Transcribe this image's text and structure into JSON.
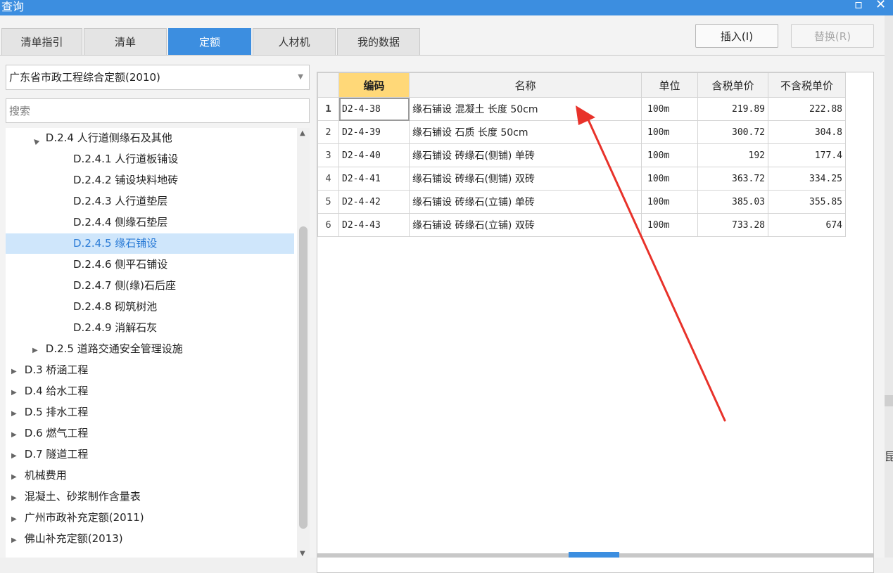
{
  "window": {
    "title": "查询",
    "restore_glyph": "▫",
    "close_glyph": "✕"
  },
  "tabs": [
    {
      "label": "清单指引",
      "active": false
    },
    {
      "label": "清单",
      "active": false
    },
    {
      "label": "定额",
      "active": true
    },
    {
      "label": "人材机",
      "active": false
    },
    {
      "label": "我的数据",
      "active": false
    }
  ],
  "actions": {
    "insert_label": "插入(I)",
    "replace_label": "替换(R)"
  },
  "library_select": {
    "value": "广东省市政工程综合定额(2010)"
  },
  "search": {
    "placeholder": "搜索"
  },
  "tree": [
    {
      "label": "D.2.4 人行道侧缘石及其他",
      "level": 1,
      "expander": "▲"
    },
    {
      "label": "D.2.4.1 人行道板铺设",
      "level": 2
    },
    {
      "label": "D.2.4.2 铺设块料地砖",
      "level": 2
    },
    {
      "label": "D.2.4.3 人行道垫层",
      "level": 2
    },
    {
      "label": "D.2.4.4 侧缘石垫层",
      "level": 2
    },
    {
      "label": "D.2.4.5 缘石铺设",
      "level": 2,
      "selected": true
    },
    {
      "label": "D.2.4.6 侧平石铺设",
      "level": 2
    },
    {
      "label": "D.2.4.7 侧(缘)石后座",
      "level": 2
    },
    {
      "label": "D.2.4.8 砌筑树池",
      "level": 2
    },
    {
      "label": "D.2.4.9 消解石灰",
      "level": 2
    },
    {
      "label": "D.2.5 道路交通安全管理设施",
      "level": 1,
      "expander": "▶"
    },
    {
      "label": "D.3 桥涵工程",
      "level": 0,
      "expander": "▶"
    },
    {
      "label": "D.4 给水工程",
      "level": 0,
      "expander": "▶"
    },
    {
      "label": "D.5 排水工程",
      "level": 0,
      "expander": "▶"
    },
    {
      "label": "D.6 燃气工程",
      "level": 0,
      "expander": "▶"
    },
    {
      "label": "D.7 隧道工程",
      "level": 0,
      "expander": "▶"
    },
    {
      "label": "机械费用",
      "level": 0,
      "expander": "▶"
    },
    {
      "label": "混凝土、砂浆制作含量表",
      "level": 0,
      "expander": "▶"
    },
    {
      "label": "广州市政补充定额(2011)",
      "level": 0,
      "expander": "▶"
    },
    {
      "label": "佛山补充定额(2013)",
      "level": 0,
      "expander": "▶"
    }
  ],
  "table": {
    "columns": [
      "编码",
      "名称",
      "单位",
      "含税单价",
      "不含税单价"
    ],
    "rows": [
      {
        "n": "1",
        "code": "D2-4-38",
        "name": "缘石铺设 混凝土 长度 50cm",
        "unit": "100m",
        "tax_price": "219.89",
        "notax_price": "222.88"
      },
      {
        "n": "2",
        "code": "D2-4-39",
        "name": "缘石铺设 石质 长度 50cm",
        "unit": "100m",
        "tax_price": "300.72",
        "notax_price": "304.8"
      },
      {
        "n": "3",
        "code": "D2-4-40",
        "name": "缘石铺设 砖缘石(侧铺) 单砖",
        "unit": "100m",
        "tax_price": "192",
        "notax_price": "177.4"
      },
      {
        "n": "4",
        "code": "D2-4-41",
        "name": "缘石铺设 砖缘石(侧铺) 双砖",
        "unit": "100m",
        "tax_price": "363.72",
        "notax_price": "334.25"
      },
      {
        "n": "5",
        "code": "D2-4-42",
        "name": "缘石铺设 砖缘石(立铺) 单砖",
        "unit": "100m",
        "tax_price": "385.03",
        "notax_price": "355.85"
      },
      {
        "n": "6",
        "code": "D2-4-43",
        "name": "缘石铺设 砖缘石(立铺) 双砖",
        "unit": "100m",
        "tax_price": "733.28",
        "notax_price": "674"
      }
    ]
  },
  "colors": {
    "accent": "#3c8ee0",
    "header_highlight": "#ffd878",
    "selected_row": "#cfe6fb",
    "annotation_arrow": "#e8322a"
  },
  "right_edge_glyph": "昆"
}
